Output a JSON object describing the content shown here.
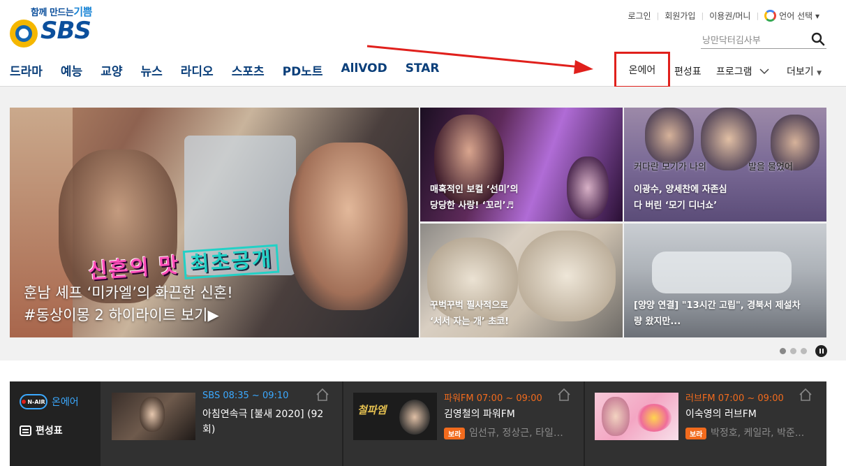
{
  "logo": {
    "slogan_pre": "함께 만드는",
    "slogan_em": "기쁨",
    "text": "SBS"
  },
  "util": {
    "login": "로그인",
    "join": "회원가입",
    "voucher": "이용권/머니",
    "lang": "언어 선택 ▾"
  },
  "search": {
    "placeholder": "낭만닥터김사부"
  },
  "gnb": [
    "드라마",
    "예능",
    "교양",
    "뉴스",
    "라디오",
    "스포츠",
    "PD노트",
    "AllVOD",
    "STAR"
  ],
  "gnb_right": {
    "onair": "온에어",
    "schedule": "편성표",
    "program": "프로그램",
    "more": "더보기"
  },
  "hero": {
    "main": {
      "sign_main": "신혼의 맛",
      "sign_sub": "최초공개",
      "line1": "훈남 셰프 ‘미카엘’의 화끈한 신혼!",
      "line2": "#동상이몽 2 하이라이트 보기▶"
    },
    "tiles": [
      {
        "line1": "매혹적인 보컬 ‘선미’의",
        "line2": "당당한 사랑! ‘꼬리’♬"
      },
      {
        "top": "커다란 모기가 나의",
        "top2": "발을 물었어",
        "line1": "이광수, 양세찬에 자존심",
        "line2": "다 버린 ‘모기 디너쇼’"
      },
      {
        "line1": "꾸벅꾸벅 필사적으로",
        "line2": "‘서서 자는 개’ 초코!"
      },
      {
        "line1": "[양양 연결] \"13시간 고립\", 경북서 제설차",
        "line2": "량 왔지만..."
      }
    ]
  },
  "live": {
    "badge": "N-AIR",
    "onair": "온에어",
    "schedule": "편성표",
    "cards": [
      {
        "time": "SBS 08:35 ~ 09:10",
        "prog": "아침연속극 [불새 2020] (92회)",
        "time_color": "#3ba9ff"
      },
      {
        "time": "파워FM 07:00 ~ 09:00",
        "prog": "김영철의 파워FM",
        "bora": "보라",
        "cast": "임선규, 정상근, 타일러...",
        "time_color": "#f26b1d"
      },
      {
        "time": "러브FM 07:00 ~ 09:00",
        "prog": "이숙영의 러브FM",
        "bora": "보라",
        "cast": "박정호, 케일라, 박준...",
        "time_color": "#f26b1d"
      }
    ]
  }
}
